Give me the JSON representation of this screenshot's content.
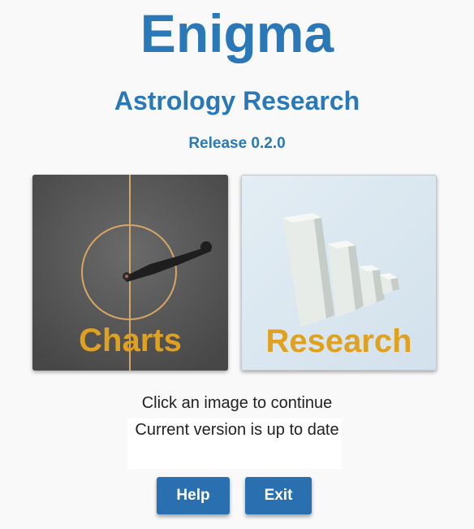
{
  "header": {
    "title": "Enigma",
    "subtitle": "Astrology Research",
    "release": "Release 0.2.0"
  },
  "tiles": {
    "charts": {
      "label": "Charts"
    },
    "research": {
      "label": "Research"
    }
  },
  "messages": {
    "instruction": "Click an image to continue",
    "status": "Current version is up to date"
  },
  "buttons": {
    "help": "Help",
    "exit": "Exit"
  },
  "colors": {
    "title": "#2a78b8",
    "button": "#2a6fb0",
    "tile_label": "#e0a020"
  }
}
